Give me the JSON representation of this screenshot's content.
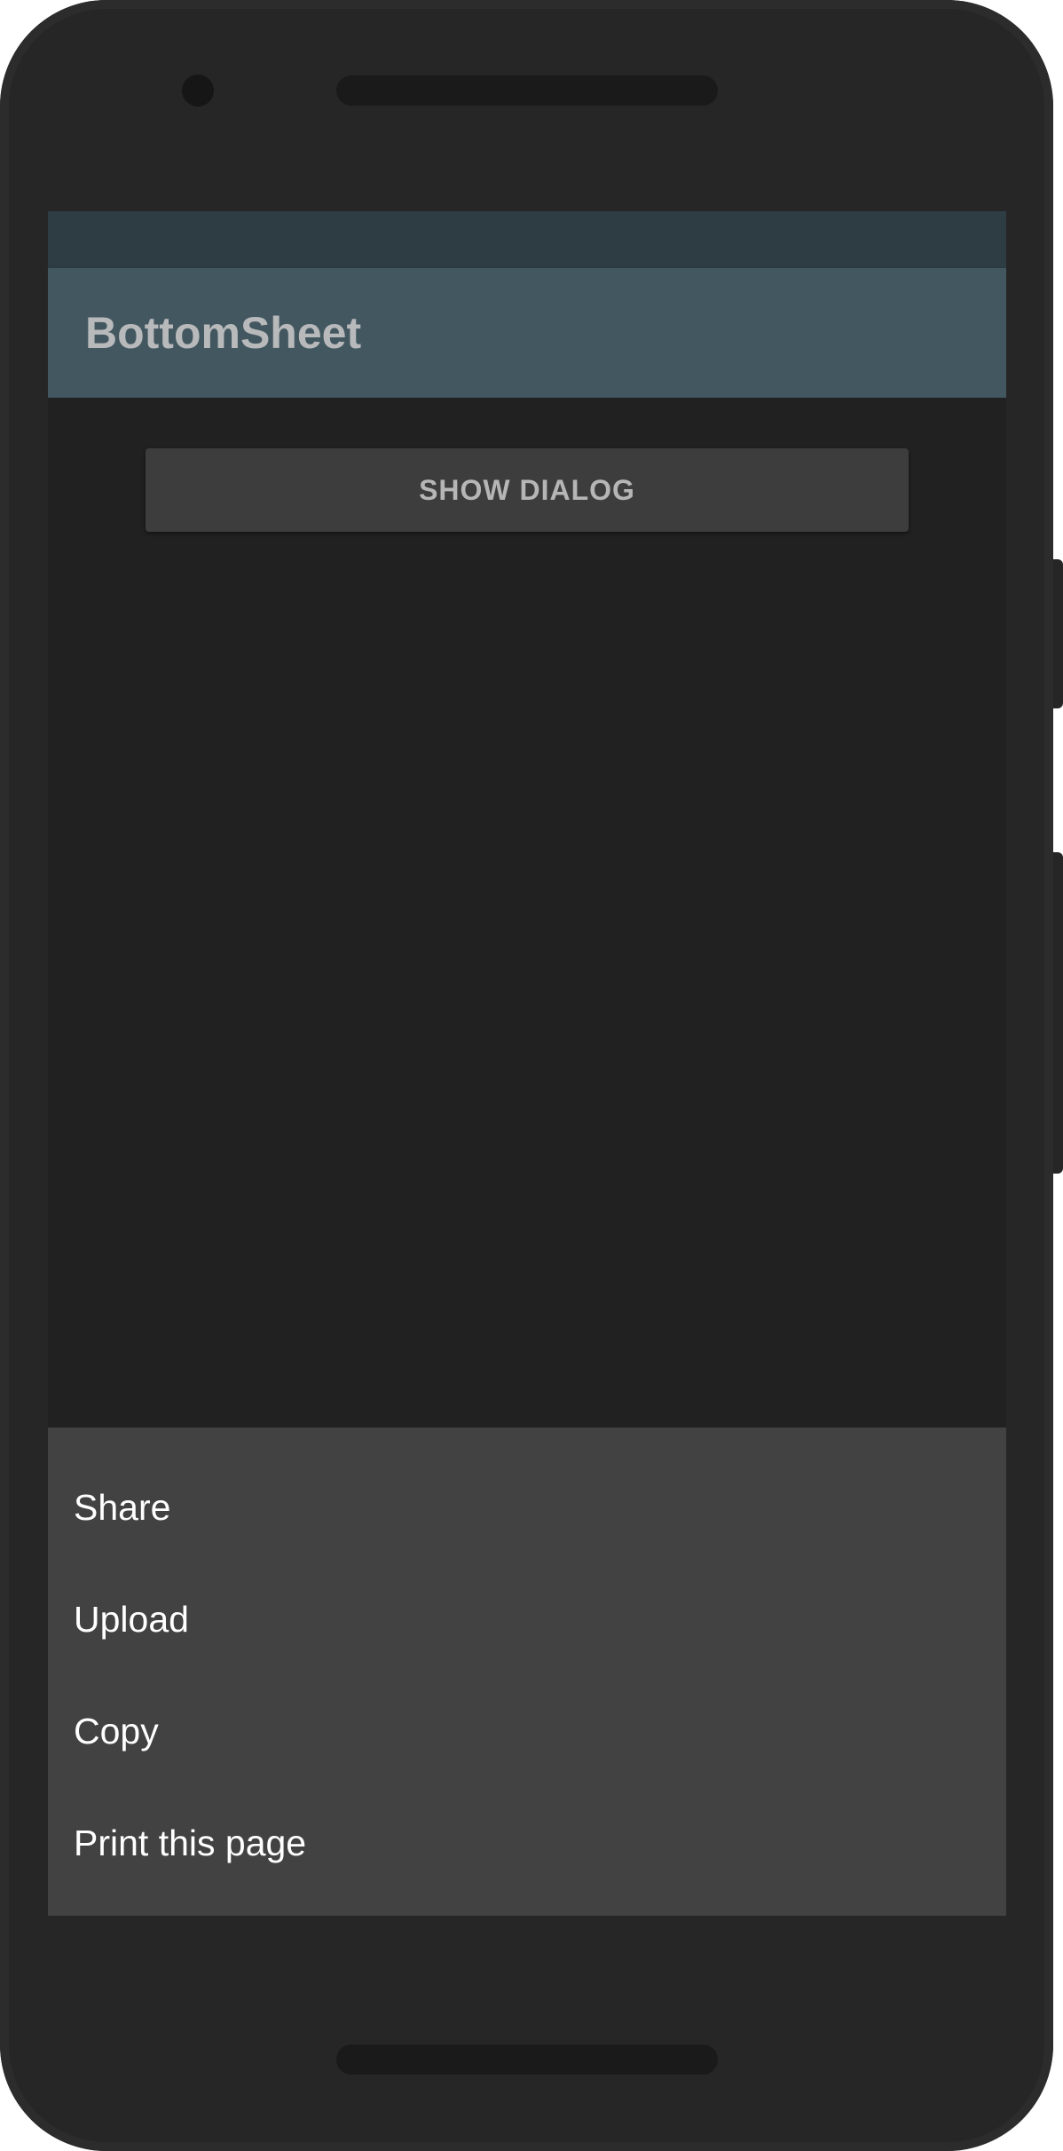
{
  "app_bar": {
    "title": "BottomSheet"
  },
  "main": {
    "show_dialog_label": "SHOW DIALOG"
  },
  "bottom_sheet": {
    "items": [
      {
        "label": "Share"
      },
      {
        "label": "Upload"
      },
      {
        "label": "Copy"
      },
      {
        "label": "Print this page"
      }
    ]
  },
  "colors": {
    "status_bar": "#2e3c43",
    "app_bar": "#435760",
    "background": "#212121",
    "button": "#3d3d3e",
    "bottom_sheet": "#424242",
    "device_frame": "#262626"
  }
}
